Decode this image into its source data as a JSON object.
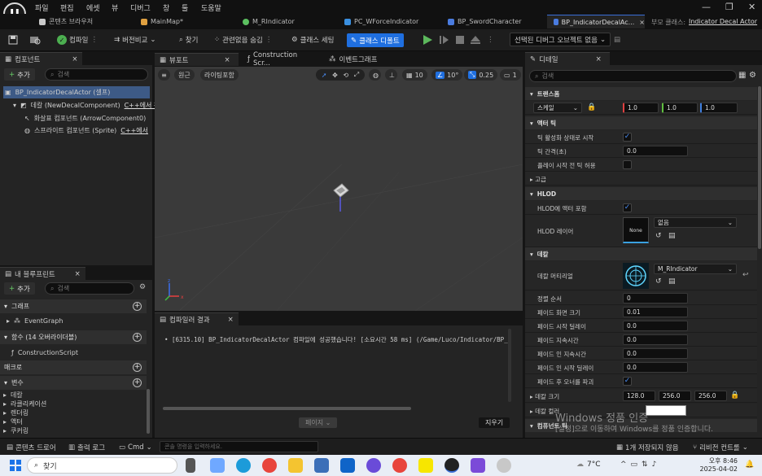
{
  "menu": [
    "파일",
    "편집",
    "에셋",
    "뷰",
    "디버그",
    "창",
    "툴",
    "도움말"
  ],
  "tabs": [
    {
      "label": "콘텐츠 브라우저",
      "color": "#c8c8c8"
    },
    {
      "label": "MainMap*",
      "color": "#e0a040"
    },
    {
      "label": "M_RIndicator",
      "color": "#5cc060"
    },
    {
      "label": "PC_WForceIndicator",
      "color": "#3a8fe0"
    },
    {
      "label": "BP_SwordCharacter",
      "color": "#4a7ce0"
    },
    {
      "label": "BP_IndicatorDecalAc...",
      "color": "#4a7ce0",
      "close": "×"
    }
  ],
  "parent_class": {
    "label": "부모 클래스:",
    "value": "Indicator Decal Actor"
  },
  "toolbar": {
    "compile": "컴파일",
    "diff": "버전비교",
    "find": "찾기",
    "hide_unrelated": "관련없음 숨김",
    "class_settings": "클래스 세팅",
    "class_defaults": "클래스 디폴트",
    "debug_object": "선택된 디버그 오브젝트 없음"
  },
  "components": {
    "tab": "컴포넌트",
    "add": "추가",
    "search_placeholder": "검색",
    "items": [
      {
        "label": "BP_IndicatorDecalActor (셀프)"
      },
      {
        "label": "데칼 (NewDecalComponent)",
        "link": "C++에서 편"
      },
      {
        "label": "화살표 컴포넌트 (ArrowComponent0)"
      },
      {
        "label": "스프라이트 컴포넌트 (Sprite)",
        "link": "C++에서"
      }
    ]
  },
  "my_blueprint": {
    "tab": "내 블루프린트",
    "add": "추가",
    "search_placeholder": "검색",
    "sections": {
      "graph": "그래프",
      "functions": "함수 (14 오버라이더블)",
      "macros": "매크로",
      "variables": "변수"
    },
    "graph_item": "EventGraph",
    "function_item": "ConstructionScript",
    "var_items": [
      "데칼",
      "라클리케이션",
      "렌더링",
      "액터",
      "쿠커링"
    ]
  },
  "editor_tabs": [
    "뷰포트",
    "Construction Scr...",
    "이벤트그래프"
  ],
  "viewport": {
    "perspective": "원근",
    "lit": "라이팅포함",
    "grid": "10",
    "angle": "10°",
    "scale": "0.25",
    "cams": "1"
  },
  "compiler": {
    "tab": "컴파일러 결과",
    "message": "[6315.10] BP_IndicatorDecalActor 컴파일에 성공했습니다! [소요시간 58 ms] (/Game/Luco/Indicator/BP_",
    "page_btn": "페이지",
    "clear_btn": "지우기"
  },
  "details": {
    "tab": "디테일",
    "search_placeholder": "검색",
    "transform": "트랜스폼",
    "scale_label": "스케일",
    "scale": [
      "1.0",
      "1.0",
      "1.0"
    ],
    "actor_tick": "액터 틱",
    "tick_enabled": "틱 활성화 상태로 시작",
    "tick_interval": "틱 간격(초)",
    "tick_interval_val": "0.0",
    "tick_before_play": "플레이 시작 전 틱 허용",
    "advanced": "고급",
    "hlod": "HLOD",
    "hlod_include": "HLOD에 액터 포함",
    "hlod_layer": "HLOD 레이어",
    "hlod_layer_val": "없음",
    "none_thumb": "None",
    "decal": "데칼",
    "decal_material": "데칼 머티리얼",
    "decal_material_val": "M_RIndicator",
    "sort_order": "정렬 순서",
    "sort_order_val": "0",
    "fade_screen": "페이드 화면 크기",
    "fade_screen_val": "0.01",
    "fade_start": "페이드 시작 딜레이",
    "fade_start_val": "0.0",
    "fade_duration": "페이드 지속시간",
    "fade_duration_val": "0.0",
    "fade_in_duration": "페이드 인 지속시간",
    "fade_in_duration_val": "0.0",
    "fade_in_start": "페이드 인 시작 딜레이",
    "fade_in_start_val": "0.0",
    "destroy_after_fade": "페이드 후 오너를 파괴",
    "decal_size": "데칼 크기",
    "decal_size_val": [
      "128.0",
      "256.0",
      "256.0"
    ],
    "decal_color": "데칼 컬러",
    "hidden_section": "컴퓨넌트 틱"
  },
  "watermark": {
    "title": "Windows 정품 인증",
    "sub": "[설정]으로 이동하여 Windows를 정품 인증합니다."
  },
  "status": {
    "content_drawer": "콘텐츠 드로어",
    "output_log": "출력 로그",
    "cmd": "Cmd",
    "cmd_placeholder": "콘솔 명령을 입력하세요.",
    "unsaved": "1개 저장되지 않음",
    "revision": "리비전 컨트롤"
  },
  "taskbar": {
    "search": "찾기",
    "weather": "7°C",
    "time": "오후 8:46",
    "date": "2025-04-02"
  }
}
